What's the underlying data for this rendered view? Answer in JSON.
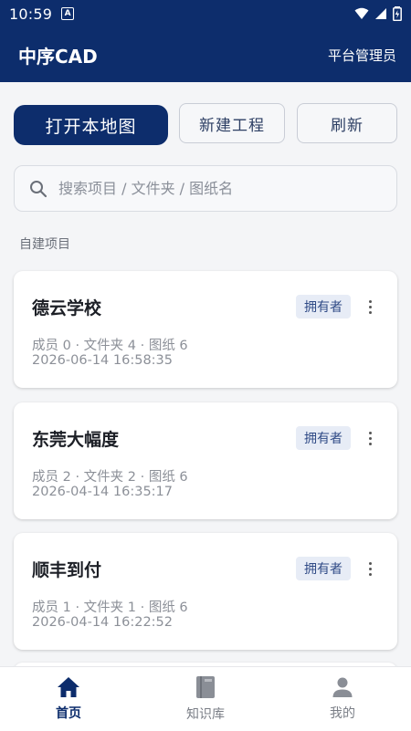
{
  "status_bar": {
    "time": "10:59",
    "notification_letter": "A"
  },
  "app_bar": {
    "title": "中序CAD",
    "role": "平台管理员"
  },
  "actions": {
    "open_local": "打开本地图",
    "new_project": "新建工程",
    "refresh": "刷新"
  },
  "search": {
    "placeholder": "搜索项目 / 文件夹 / 图纸名",
    "value": ""
  },
  "section": {
    "label": "自建项目"
  },
  "projects": [
    {
      "name": "德云学校",
      "badge": "拥有者",
      "meta": "成员 0 · 文件夹 4 · 图纸 6",
      "time": "2026-06-14 16:58:35"
    },
    {
      "name": "东莞大幅度",
      "badge": "拥有者",
      "meta": "成员 2 · 文件夹 2 · 图纸 6",
      "time": "2026-04-14 16:35:17"
    },
    {
      "name": "顺丰到付",
      "badge": "拥有者",
      "meta": "成员 1 · 文件夹 1 · 图纸 6",
      "time": "2026-04-14 16:22:52"
    }
  ],
  "bottom_nav": [
    {
      "label": "首页",
      "icon": "home-icon",
      "active": true
    },
    {
      "label": "知识库",
      "icon": "book-icon",
      "active": false
    },
    {
      "label": "我的",
      "icon": "person-icon",
      "active": false
    }
  ],
  "colors": {
    "primary": "#0d2d6c",
    "badge_bg": "#e7ecf6",
    "badge_text": "#2f4a86"
  }
}
